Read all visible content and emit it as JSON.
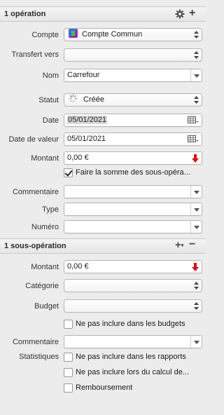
{
  "operation_header": {
    "title": "1 opération"
  },
  "compte": {
    "label": "Compte",
    "value": "Compte Commun"
  },
  "transfert": {
    "label": "Transfert vers",
    "value": ""
  },
  "nom": {
    "label": "Nom",
    "value": "Carrefour"
  },
  "statut": {
    "label": "Statut",
    "value": "Créée"
  },
  "date": {
    "label": "Date",
    "value": "05/01/2021"
  },
  "date_valeur": {
    "label": "Date de valeur",
    "value": "05/01/2021"
  },
  "montant": {
    "label": "Montant",
    "value": "0,00 €"
  },
  "sum_sub": {
    "label": "Faire la somme des sous-opéra...",
    "checked": true
  },
  "commentaire": {
    "label": "Commentaire",
    "value": ""
  },
  "type": {
    "label": "Type",
    "value": ""
  },
  "numero": {
    "label": "Numéro",
    "value": ""
  },
  "sub_header": {
    "title": "1 sous-opération"
  },
  "sub": {
    "montant": {
      "label": "Montant",
      "value": "0,00 €"
    },
    "categorie": {
      "label": "Catégorie",
      "value": ""
    },
    "budget": {
      "label": "Budget",
      "value": ""
    },
    "exclude_budgets": {
      "label": "Ne pas inclure dans les budgets",
      "checked": false
    },
    "commentaire": {
      "label": "Commentaire",
      "value": ""
    },
    "statistiques": {
      "label": "Statistiques"
    },
    "exclude_reports": {
      "label": "Ne pas inclure dans les rapports",
      "checked": false
    },
    "exclude_calc": {
      "label": "Ne pas inclure lors du calcul de...",
      "checked": false
    },
    "remboursement": {
      "label": "Remboursement",
      "checked": false
    }
  },
  "colors": {
    "accent_red": "#d8101a",
    "bg": "#ececec"
  }
}
